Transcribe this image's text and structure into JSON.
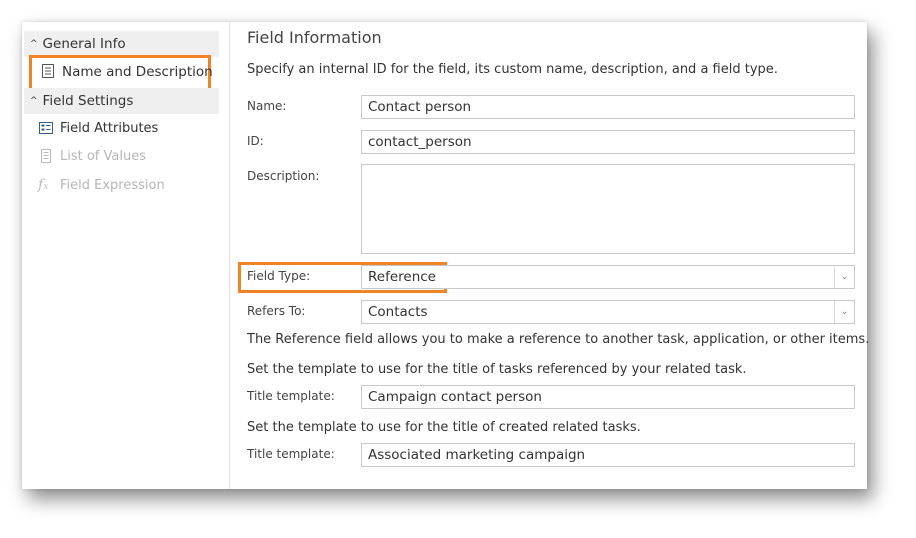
{
  "sidebar": {
    "general_info": {
      "label": "General Info",
      "caret": "^"
    },
    "name_and_description": {
      "label": "Name and Description",
      "icon": "document-icon"
    },
    "field_settings": {
      "label": "Field Settings",
      "caret": "^"
    },
    "items": [
      {
        "label": "Field Attributes",
        "icon": "attributes-icon",
        "enabled": true
      },
      {
        "label": "List of Values",
        "icon": "list-icon",
        "enabled": false
      },
      {
        "label": "Field Expression",
        "icon": "function-icon",
        "enabled": false
      }
    ]
  },
  "main": {
    "title": "Field Information",
    "intro": "Specify an internal ID for the field, its custom name, description, and a field type.",
    "name": {
      "label": "Name:",
      "value": "Contact person"
    },
    "id": {
      "label": "ID:",
      "value": "contact_person"
    },
    "description": {
      "label": "Description:",
      "value": ""
    },
    "field_type": {
      "label": "Field Type:",
      "value": "Reference"
    },
    "refers_to": {
      "label": "Refers To:",
      "value": "Contacts"
    },
    "reference_note": "The Reference field allows you to make a reference to another task, application, or other items.",
    "template_note_1": "Set the template to use for the title of tasks referenced by your related task.",
    "title_template_1": {
      "label": "Title template:",
      "value": "Campaign contact person"
    },
    "template_note_2": "Set the template to use for the title of created related tasks.",
    "title_template_2": {
      "label": "Title template:",
      "value": "Associated marketing campaign"
    }
  },
  "colors": {
    "highlight": "#f08324",
    "header_bg": "#efefef",
    "disabled_text": "#b6b6b6"
  }
}
